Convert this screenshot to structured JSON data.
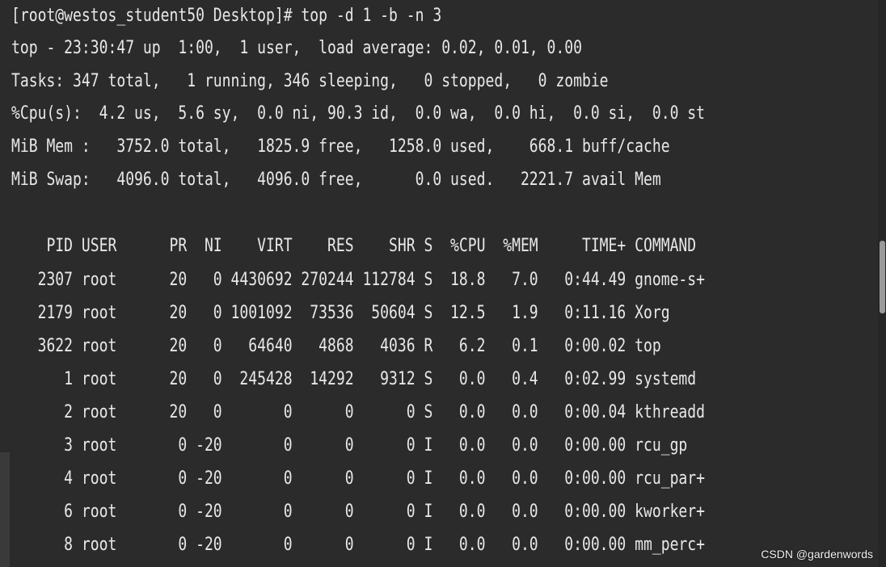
{
  "terminal": {
    "command_line": "[root@westos_student50 Desktop]# top -d 1 -b -n 3",
    "summary": {
      "uptime": "top - 23:30:47 up  1:00,  1 user,  load average: 0.02, 0.01, 0.00",
      "tasks": "Tasks: 347 total,   1 running, 346 sleeping,   0 stopped,   0 zombie",
      "cpu": "%Cpu(s):  4.2 us,  5.6 sy,  0.0 ni, 90.3 id,  0.0 wa,  0.0 hi,  0.0 si,  0.0 st",
      "mem": "MiB Mem :   3752.0 total,   1825.9 free,   1258.0 used,    668.1 buff/cache",
      "swap": "MiB Swap:   4096.0 total,   4096.0 free,      0.0 used.   2221.7 avail Mem"
    },
    "table_header": "    PID USER      PR  NI    VIRT    RES    SHR S  %CPU  %MEM     TIME+ COMMAND",
    "rows": [
      "   2307 root      20   0 4430692 270244 112784 S  18.8   7.0   0:44.49 gnome-s+",
      "   2179 root      20   0 1001092  73536  50604 S  12.5   1.9   0:11.16 Xorg",
      "   3622 root      20   0   64640   4868   4036 R   6.2   0.1   0:00.02 top",
      "      1 root      20   0  245428  14292   9312 S   0.0   0.4   0:02.99 systemd",
      "      2 root      20   0       0      0      0 S   0.0   0.0   0:00.04 kthreadd",
      "      3 root       0 -20       0      0      0 I   0.0   0.0   0:00.00 rcu_gp",
      "      4 root       0 -20       0      0      0 I   0.0   0.0   0:00.00 rcu_par+",
      "      6 root       0 -20       0      0      0 I   0.0   0.0   0:00.00 kworker+",
      "      8 root       0 -20       0      0      0 I   0.0   0.0   0:00.00 mm_perc+"
    ]
  },
  "watermark": "CSDN @gardenwords",
  "colors": {
    "background": "#2b2b2b",
    "text": "#e8e8e8"
  }
}
